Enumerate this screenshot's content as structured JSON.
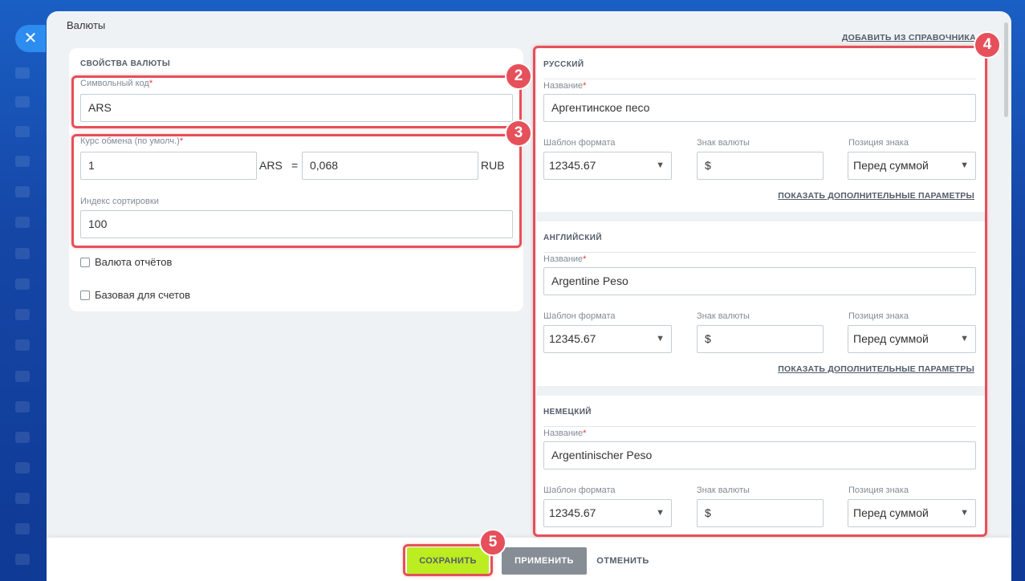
{
  "window": {
    "title": "Валюты",
    "add_from_directory": "ДОБАВИТЬ ИЗ СПРАВОЧНИКА"
  },
  "properties": {
    "section_title": "СВОЙСТВА ВАЛЮТЫ",
    "symbol_code_label": "Символьный код",
    "symbol_code_value": "ARS",
    "rate_label": "Курс обмена (по умолч.)",
    "rate_amount": "1",
    "rate_from": "ARS",
    "rate_eq": "=",
    "rate_value": "0,068",
    "rate_to": "RUB",
    "sort_label": "Индекс сортировки",
    "sort_value": "100",
    "report_currency_label": "Валюта отчётов",
    "base_for_invoices_label": "Базовая для счетов",
    "required_mark": "*"
  },
  "languages": [
    {
      "title": "РУССКИЙ",
      "name_label": "Название",
      "name_value": "Аргентинское песо",
      "format_label": "Шаблон формата",
      "format_value": "12345.67",
      "sign_label": "Знак валюты",
      "sign_value": "$",
      "position_label": "Позиция знака",
      "position_value": "Перед суммой",
      "more_link": "ПОКАЗАТЬ ДОПОЛНИТЕЛЬНЫЕ ПАРАМЕТРЫ"
    },
    {
      "title": "АНГЛИЙСКИЙ",
      "name_label": "Название",
      "name_value": "Argentine Peso",
      "format_label": "Шаблон формата",
      "format_value": "12345.67",
      "sign_label": "Знак валюты",
      "sign_value": "$",
      "position_label": "Позиция знака",
      "position_value": "Перед суммой",
      "more_link": "ПОКАЗАТЬ ДОПОЛНИТЕЛЬНЫЕ ПАРАМЕТРЫ"
    },
    {
      "title": "НЕМЕЦКИЙ",
      "name_label": "Название",
      "name_value": "Argentinischer Peso",
      "format_label": "Шаблон формата",
      "format_value": "12345.67",
      "sign_label": "Знак валюты",
      "sign_value": "$",
      "position_label": "Позиция знака",
      "position_value": "Перед суммой"
    }
  ],
  "badges": [
    "2",
    "3",
    "4",
    "5"
  ],
  "footer": {
    "save": "СОХРАНИТЬ",
    "apply": "ПРИМЕНИТЬ",
    "cancel": "ОТМЕНИТЬ"
  },
  "colors": {
    "highlight": "#e5505a",
    "save_button": "#bbed21",
    "apply_button": "#868d95",
    "close_button": "#2d8cf0"
  },
  "icons": {
    "close": "close-icon",
    "dropdown": "chevron-down-icon"
  }
}
